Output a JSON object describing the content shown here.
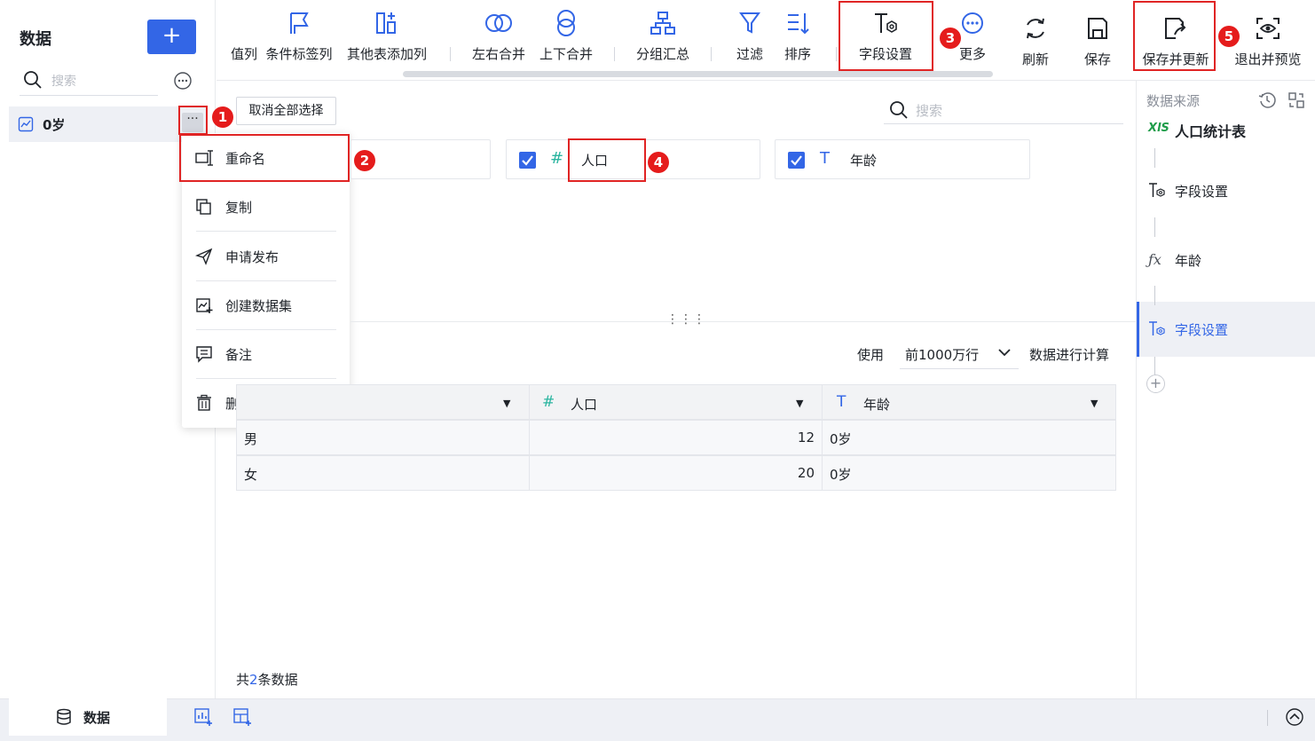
{
  "sidebar": {
    "title": "数据",
    "add_label": "+",
    "search_placeholder": "搜索",
    "item_label": "0岁",
    "item_more": "···"
  },
  "context_menu": {
    "items": [
      {
        "label": "重命名",
        "icon": "rename-icon"
      },
      {
        "label": "复制",
        "icon": "copy-icon"
      },
      {
        "label": "申请发布",
        "icon": "send-icon"
      },
      {
        "label": "创建数据集",
        "icon": "create-dataset-icon"
      },
      {
        "label": "备注",
        "icon": "note-icon"
      },
      {
        "label": "删除",
        "icon": "trash-icon"
      }
    ]
  },
  "toolbar": {
    "items": [
      {
        "label": "值列",
        "icon": "column-icon"
      },
      {
        "label": "条件标签列",
        "icon": "flag-icon"
      },
      {
        "label": "其他表添加列",
        "icon": "add-column-icon"
      },
      {
        "label": "左右合并",
        "icon": "merge-horizontal-icon"
      },
      {
        "label": "上下合并",
        "icon": "merge-vertical-icon"
      },
      {
        "label": "分组汇总",
        "icon": "group-icon"
      },
      {
        "label": "过滤",
        "icon": "filter-icon"
      },
      {
        "label": "排序",
        "icon": "sort-icon"
      },
      {
        "label": "字段设置",
        "icon": "field-settings-icon"
      },
      {
        "label": "更多",
        "icon": "more-icon"
      },
      {
        "label": "刷新",
        "icon": "refresh-icon"
      },
      {
        "label": "保存",
        "icon": "save-icon"
      },
      {
        "label": "保存并更新",
        "icon": "save-update-icon"
      },
      {
        "label": "退出并预览",
        "icon": "preview-icon"
      }
    ]
  },
  "fields": {
    "deselect_all": "取消全部选择",
    "search_placeholder": "搜索",
    "cards": [
      {
        "name": "",
        "type": "",
        "checked": false
      },
      {
        "name": "人口",
        "type": "#",
        "checked": true
      },
      {
        "name": "年龄",
        "type": "T",
        "checked": true
      }
    ]
  },
  "preview": {
    "use_label": "使用",
    "rows_option": "前1000万行",
    "calc_label": "数据进行计算",
    "columns": [
      {
        "name": "",
        "type": ""
      },
      {
        "name": "人口",
        "type": "#"
      },
      {
        "name": "年龄",
        "type": "T"
      }
    ],
    "rows": [
      [
        "男",
        "12",
        "0岁"
      ],
      [
        "女",
        "20",
        "0岁"
      ]
    ],
    "total_prefix": "共",
    "total_count": "2",
    "total_suffix": "条数据"
  },
  "right_panel": {
    "title": "数据来源",
    "source_icon": "XlS",
    "source_name": "人口统计表",
    "steps": [
      {
        "label": "字段设置",
        "icon": "field-settings-icon"
      },
      {
        "label": "年龄",
        "icon": "fx-icon"
      },
      {
        "label": "字段设置",
        "icon": "field-settings-icon",
        "active": true
      }
    ],
    "add_label": "+"
  },
  "bottom": {
    "tab_label": "数据"
  },
  "annotations": [
    "1",
    "2",
    "3",
    "4",
    "5"
  ],
  "colors": {
    "accent": "#3366e6",
    "highlight": "#e02424",
    "badge": "#e51c1c",
    "number_type": "#2bb5a0"
  }
}
